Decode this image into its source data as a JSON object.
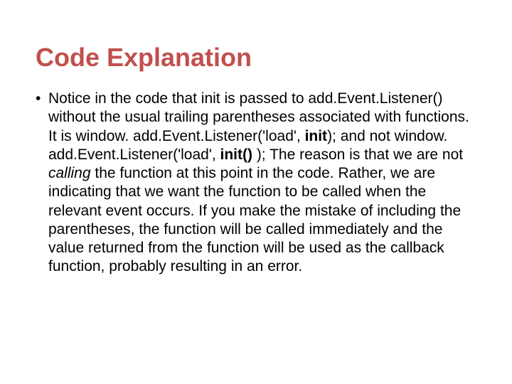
{
  "title": "Code Explanation",
  "bullet_char": "•",
  "body": {
    "segments": [
      {
        "text": "Notice in the code that init is passed to add.Event.Listener() without the usual trailing parentheses associated with functions. It is window. add.Event.Listener('load', ",
        "style": ""
      },
      {
        "text": "init",
        "style": "bold"
      },
      {
        "text": "); and not window. add.Event.Listener('load', ",
        "style": ""
      },
      {
        "text": "init()",
        "style": "bold"
      },
      {
        "text": " ); The reason is that we are not ",
        "style": ""
      },
      {
        "text": "calling",
        "style": "italic"
      },
      {
        "text": " the function at this point in the code. Rather, we are indicating that we want the function to be called when the relevant event occurs. If you make the mistake of including the parentheses, the function will be called immediately and the value returned from the function will be used as the callback function, probably resulting in an error.",
        "style": ""
      }
    ]
  }
}
